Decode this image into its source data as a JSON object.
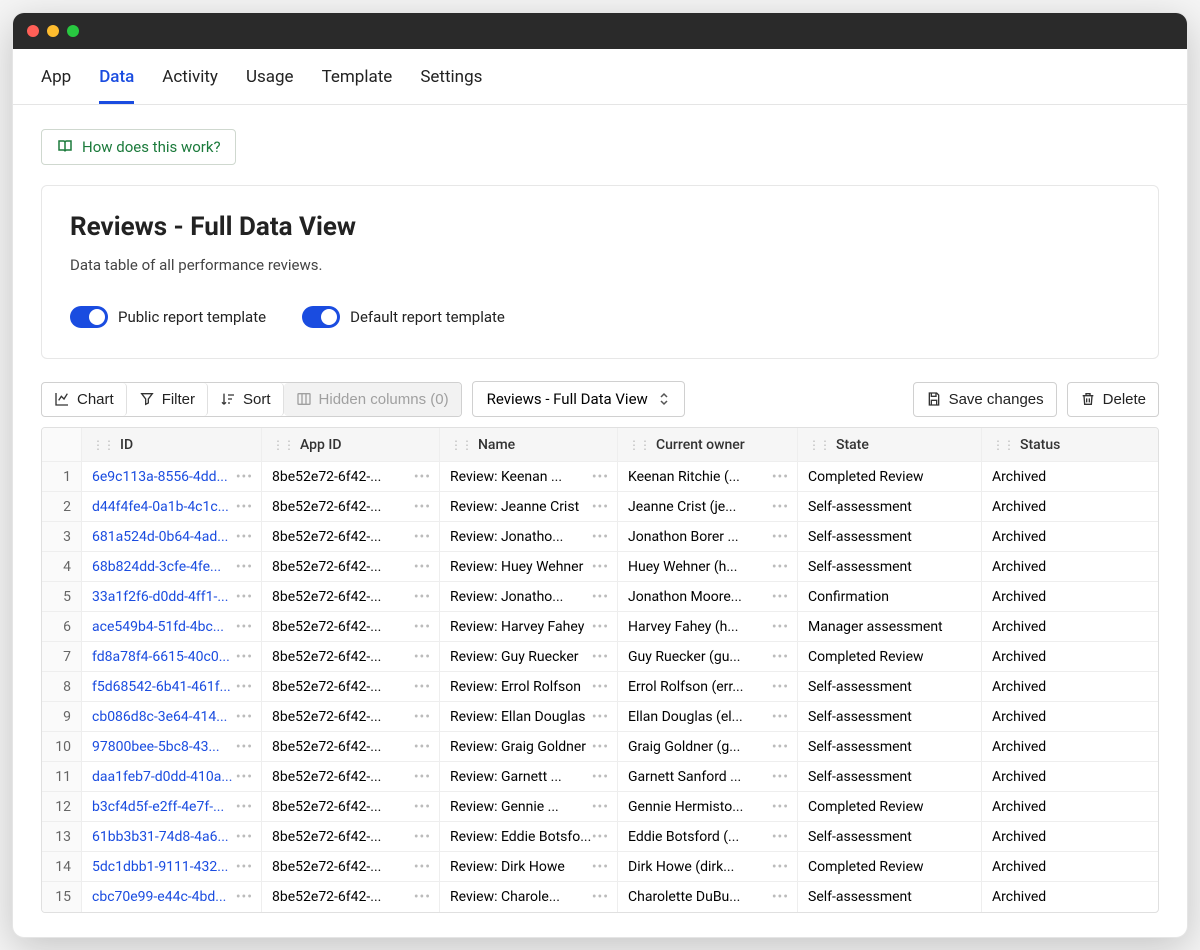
{
  "nav": {
    "tabs": [
      "App",
      "Data",
      "Activity",
      "Usage",
      "Template",
      "Settings"
    ],
    "active_index": 1
  },
  "help_link_label": "How does this work?",
  "card": {
    "title": "Reviews - Full Data View",
    "description": "Data table of all performance reviews.",
    "toggles": [
      {
        "label": "Public report template",
        "on": true
      },
      {
        "label": "Default report template",
        "on": true
      }
    ]
  },
  "toolbar": {
    "chart": "Chart",
    "filter": "Filter",
    "sort": "Sort",
    "hidden_columns": "Hidden columns (0)",
    "view_name": "Reviews - Full Data View",
    "save": "Save changes",
    "delete": "Delete"
  },
  "table": {
    "columns": [
      "ID",
      "App ID",
      "Name",
      "Current owner",
      "State",
      "Status"
    ],
    "rows": [
      {
        "n": 1,
        "id": "6e9c113a-8556-4dd...",
        "app_id": "8be52e72-6f42-...",
        "name": "Review: Keenan ...",
        "owner": "Keenan Ritchie (...",
        "state": "Completed Review",
        "status": "Archived"
      },
      {
        "n": 2,
        "id": "d44f4fe4-0a1b-4c1c...",
        "app_id": "8be52e72-6f42-...",
        "name": "Review: Jeanne Crist",
        "owner": "Jeanne Crist (je...",
        "state": "Self-assessment",
        "status": "Archived"
      },
      {
        "n": 3,
        "id": "681a524d-0b64-4ad...",
        "app_id": "8be52e72-6f42-...",
        "name": "Review: Jonatho...",
        "owner": "Jonathon Borer ...",
        "state": "Self-assessment",
        "status": "Archived"
      },
      {
        "n": 4,
        "id": "68b824dd-3cfe-4fe...",
        "app_id": "8be52e72-6f42-...",
        "name": "Review: Huey Wehner",
        "owner": "Huey Wehner (h...",
        "state": "Self-assessment",
        "status": "Archived"
      },
      {
        "n": 5,
        "id": "33a1f2f6-d0dd-4ff1-...",
        "app_id": "8be52e72-6f42-...",
        "name": "Review: Jonatho...",
        "owner": "Jonathon Moore...",
        "state": "Confirmation",
        "status": "Archived"
      },
      {
        "n": 6,
        "id": "ace549b4-51fd-4bc...",
        "app_id": "8be52e72-6f42-...",
        "name": "Review: Harvey Fahey",
        "owner": "Harvey Fahey (h...",
        "state": "Manager assessment",
        "status": "Archived"
      },
      {
        "n": 7,
        "id": "fd8a78f4-6615-40c0...",
        "app_id": "8be52e72-6f42-...",
        "name": "Review: Guy Ruecker",
        "owner": "Guy Ruecker (gu...",
        "state": "Completed Review",
        "status": "Archived"
      },
      {
        "n": 8,
        "id": "f5d68542-6b41-461f...",
        "app_id": "8be52e72-6f42-...",
        "name": "Review: Errol Rolfson",
        "owner": "Errol Rolfson (err...",
        "state": "Self-assessment",
        "status": "Archived"
      },
      {
        "n": 9,
        "id": "cb086d8c-3e64-414...",
        "app_id": "8be52e72-6f42-...",
        "name": "Review: Ellan Douglas",
        "owner": "Ellan Douglas (el...",
        "state": "Self-assessment",
        "status": "Archived"
      },
      {
        "n": 10,
        "id": "97800bee-5bc8-43...",
        "app_id": "8be52e72-6f42-...",
        "name": "Review: Graig Goldner",
        "owner": "Graig Goldner (g...",
        "state": "Self-assessment",
        "status": "Archived"
      },
      {
        "n": 11,
        "id": "daa1feb7-d0dd-410a...",
        "app_id": "8be52e72-6f42-...",
        "name": "Review: Garnett ...",
        "owner": "Garnett Sanford ...",
        "state": "Self-assessment",
        "status": "Archived"
      },
      {
        "n": 12,
        "id": "b3cf4d5f-e2ff-4e7f-...",
        "app_id": "8be52e72-6f42-...",
        "name": "Review: Gennie ...",
        "owner": "Gennie Hermisto...",
        "state": "Completed Review",
        "status": "Archived"
      },
      {
        "n": 13,
        "id": "61bb3b31-74d8-4a6...",
        "app_id": "8be52e72-6f42-...",
        "name": "Review: Eddie Botsfo...",
        "owner": "Eddie Botsford (...",
        "state": "Self-assessment",
        "status": "Archived"
      },
      {
        "n": 14,
        "id": "5dc1dbb1-9111-432...",
        "app_id": "8be52e72-6f42-...",
        "name": "Review: Dirk Howe",
        "owner": "Dirk Howe (dirk...",
        "state": "Completed Review",
        "status": "Archived"
      },
      {
        "n": 15,
        "id": "cbc70e99-e44c-4bd...",
        "app_id": "8be52e72-6f42-...",
        "name": "Review: Charole...",
        "owner": "Charolette DuBu...",
        "state": "Self-assessment",
        "status": "Archived"
      }
    ]
  }
}
